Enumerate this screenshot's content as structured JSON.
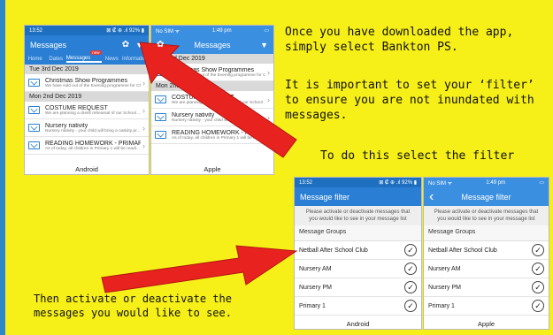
{
  "slide": {
    "top_text_1": "Once you have downloaded the app, simply select Bankton PS.",
    "top_text_2": "It is important to set your ‘filter’ to ensure you are not inundated with messages.",
    "mid_text": "To do this select the filter",
    "bottom_text": "Then activate or deactivate the messages you would like to see."
  },
  "colors": {
    "android_blue": "#2a7fd4",
    "apple_blue": "#3b8fe0",
    "arrow_red": "#e8231f",
    "background": "#f6ef18"
  },
  "phone_messages_android": {
    "status_time": "13:52",
    "status_right": "⊠ ₡ ⊕ .ıl 92% ▮",
    "title": "Messages",
    "tabs": [
      {
        "label": "Home"
      },
      {
        "label": "Dates"
      },
      {
        "label": "Messages",
        "badge": "new"
      },
      {
        "label": "News"
      },
      {
        "label": "Information"
      }
    ],
    "date_1": "Tue 3rd Dec 2019",
    "msg_1_title": "Christmas Show Programmes",
    "msg_1_sub": "We have sold out of the Evening programme for Christ...",
    "date_2": "Mon 2nd Dec 2019",
    "msg_2_title": "COSTUME REQUEST",
    "msg_2_sub": "We are planning a dress rehearsal of our School ...",
    "msg_3_title": "Nursery nativity",
    "msg_3_sub": "Nursery nativity - your child will bring a nativity pr...",
    "msg_4_title": "READING HOMEWORK - PRIMARY 1",
    "msg_4_sub": "As of today, all children in Primary 1 will be readi...",
    "caption": "Android"
  },
  "phone_messages_apple": {
    "status_left": "No SIM ᯤ",
    "status_time": "1:49 pm",
    "title": "Messages",
    "date_1": "Tue 3rd Dec 2019",
    "msg_1_title": "Christmas Show Programmes",
    "msg_1_sub": "We have sold out of the Evening programme for Christ...",
    "date_2": "Mon 2nd Dec 2019",
    "msg_2_title": "COSTUME REQUEST",
    "msg_2_sub": "We are planning a dress rehearsal of our School ...",
    "msg_3_title": "Nursery nativity",
    "msg_3_sub": "Nursery nativity - your child will bring a nativity pr...",
    "msg_4_title": "READING HOMEWORK - PRIMARY 1",
    "msg_4_sub": "As of today, all children in Primary 1 will be readi...",
    "caption": "Apple"
  },
  "phone_filter_android": {
    "status_time": "13:52",
    "status_right": "⊠ ₡ ⊕ .ıl 92% ▮",
    "title": "Message filter",
    "note": "Please activate or deactivate messages that you would like to see in your message list",
    "group_head": "Message Groups",
    "rows": [
      "Netball After School Club",
      "Nursery AM",
      "Nursery PM",
      "Primary 1"
    ],
    "caption": "Android"
  },
  "phone_filter_apple": {
    "status_left": "No SIM ᯤ",
    "status_time": "1:49 pm",
    "back": "‹",
    "title": "Message filter",
    "note": "Please activate or deactivate messages that you would like to see in your message list",
    "group_head": "Message Groups",
    "rows": [
      "Netball After School Club",
      "Nursery AM",
      "Nursery PM",
      "Primary 1"
    ],
    "caption": "Apple"
  }
}
